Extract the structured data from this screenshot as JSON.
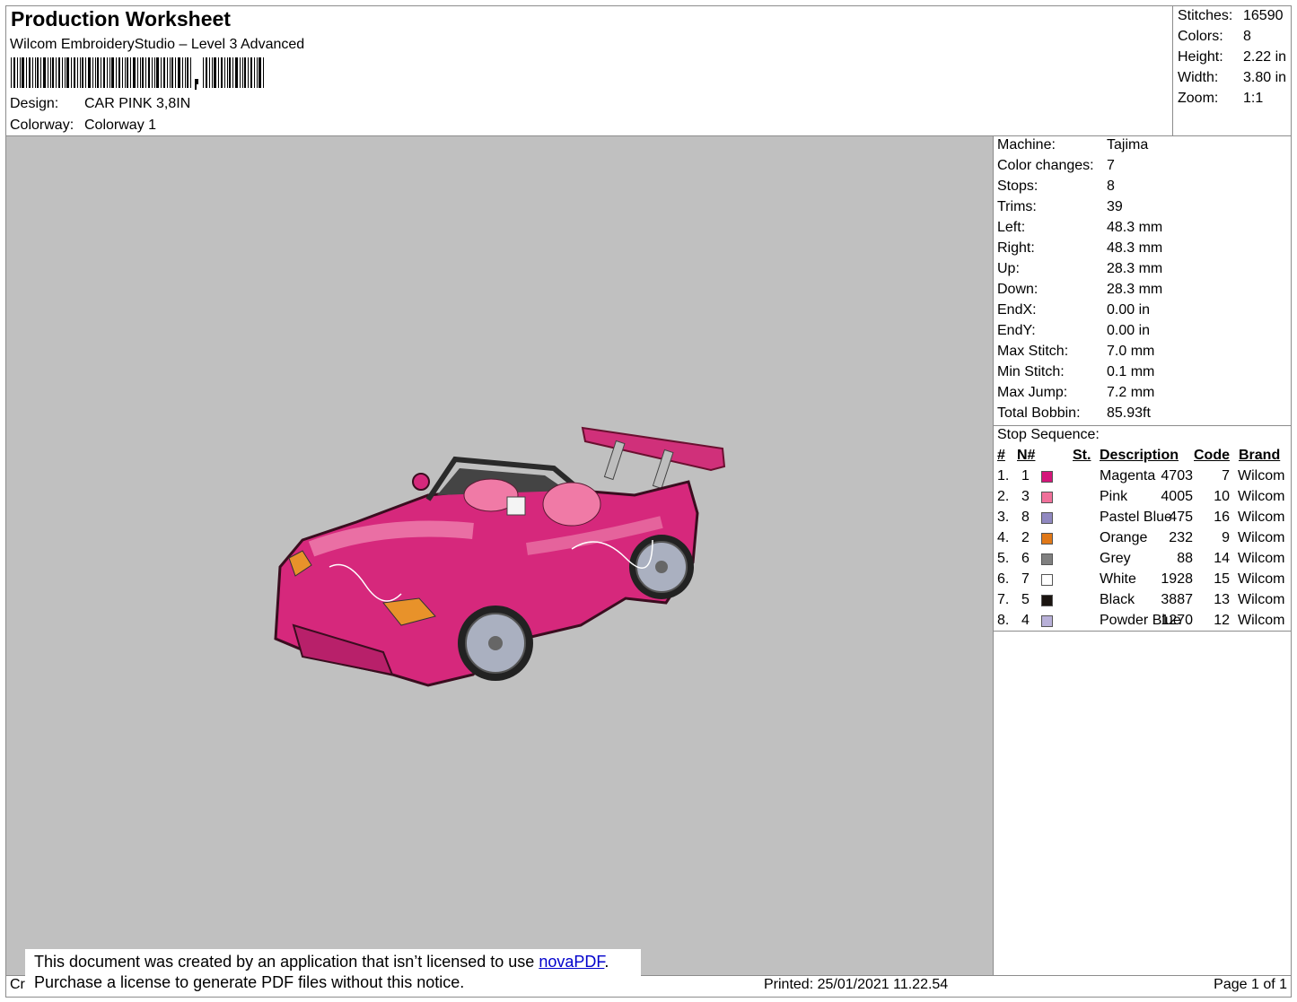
{
  "header": {
    "title": "Production Worksheet",
    "subtitle": "Wilcom EmbroideryStudio – Level 3 Advanced",
    "design_label": "Design:",
    "design_value": "CAR PINK 3,8IN",
    "colorway_label": "Colorway:",
    "colorway_value": "Colorway 1"
  },
  "summary": [
    {
      "label": "Stitches:",
      "value": "16590"
    },
    {
      "label": "Colors:",
      "value": "8"
    },
    {
      "label": "Height:",
      "value": "2.22 in"
    },
    {
      "label": "Width:",
      "value": "3.80 in"
    },
    {
      "label": "Zoom:",
      "value": "1:1"
    }
  ],
  "machine_info": [
    {
      "label": "Machine:",
      "value": "Tajima"
    },
    {
      "label": "Color changes:",
      "value": "7"
    },
    {
      "label": "Stops:",
      "value": "8"
    },
    {
      "label": "Trims:",
      "value": "39"
    },
    {
      "label": "Left:",
      "value": "48.3 mm"
    },
    {
      "label": "Right:",
      "value": "48.3 mm"
    },
    {
      "label": "Up:",
      "value": "28.3 mm"
    },
    {
      "label": "Down:",
      "value": "28.3 mm"
    },
    {
      "label": "EndX:",
      "value": "0.00 in"
    },
    {
      "label": "EndY:",
      "value": "0.00 in"
    },
    {
      "label": "Max Stitch:",
      "value": "7.0 mm"
    },
    {
      "label": "Min Stitch:",
      "value": "0.1 mm"
    },
    {
      "label": "Max Jump:",
      "value": "7.2 mm"
    },
    {
      "label": "Total Bobbin:",
      "value": "85.93ft"
    }
  ],
  "stop_sequence": {
    "title": "Stop Sequence:",
    "headers": {
      "num": "#",
      "n": "N#",
      "st": "St.",
      "desc": "Description",
      "code": "Code",
      "brand": "Brand"
    },
    "rows": [
      {
        "num": "1.",
        "n": "1",
        "st": "4703",
        "desc": "Magenta",
        "code": "7",
        "brand": "Wilcom",
        "color": "#d4167a"
      },
      {
        "num": "2.",
        "n": "3",
        "st": "4005",
        "desc": "Pink",
        "code": "10",
        "brand": "Wilcom",
        "color": "#f0709a"
      },
      {
        "num": "3.",
        "n": "8",
        "st": "475",
        "desc": "Pastel Blue",
        "code": "16",
        "brand": "Wilcom",
        "color": "#9088c0"
      },
      {
        "num": "4.",
        "n": "2",
        "st": "232",
        "desc": "Orange",
        "code": "9",
        "brand": "Wilcom",
        "color": "#e07818"
      },
      {
        "num": "5.",
        "n": "6",
        "st": "88",
        "desc": "Grey",
        "code": "14",
        "brand": "Wilcom",
        "color": "#808080"
      },
      {
        "num": "6.",
        "n": "7",
        "st": "1928",
        "desc": "White",
        "code": "15",
        "brand": "Wilcom",
        "color": "#ffffff"
      },
      {
        "num": "7.",
        "n": "5",
        "st": "3887",
        "desc": "Black",
        "code": "13",
        "brand": "Wilcom",
        "color": "#1a1410"
      },
      {
        "num": "8.",
        "n": "4",
        "st": "1270",
        "desc": "Powder Blue",
        "code": "12",
        "brand": "Wilcom",
        "color": "#b8b0d8"
      }
    ]
  },
  "footer": {
    "left_fragment": "Cr",
    "printed": "Printed: 25/01/2021 11.22.54",
    "page": "Page 1 of 1"
  },
  "notice": {
    "line1_prefix": "This document was created by an application that isn’t licensed to use ",
    "link": "novaPDF",
    "line1_suffix": ".",
    "line2": "Purchase a license to generate PDF files without this notice."
  }
}
